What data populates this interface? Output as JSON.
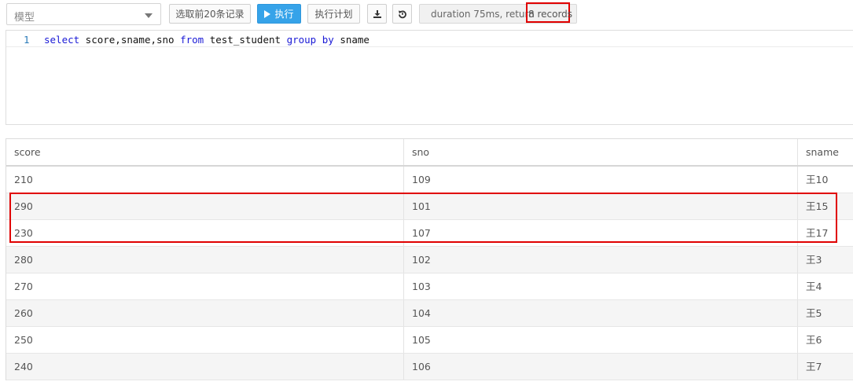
{
  "toolbar": {
    "model_select": {
      "value": "模型"
    },
    "select_top20_label": "选取前20条记录",
    "execute_label": "执行",
    "plan_label": "执行计划",
    "download_icon": "download-icon",
    "reset_icon": "undo-icon",
    "status_prefix": "duration 75ms, return ",
    "status_records": "8 records"
  },
  "editor": {
    "line_number": "1",
    "tokens": [
      {
        "text": "select",
        "kw": true
      },
      {
        "text": " score,sname,sno ",
        "kw": false
      },
      {
        "text": "from",
        "kw": true
      },
      {
        "text": " test_student ",
        "kw": false
      },
      {
        "text": "group",
        "kw": true
      },
      {
        "text": " ",
        "kw": false
      },
      {
        "text": "by",
        "kw": true
      },
      {
        "text": " sname",
        "kw": false
      }
    ]
  },
  "results": {
    "columns": [
      "score",
      "sno",
      "sname"
    ],
    "rows": [
      [
        "210",
        "109",
        "王10"
      ],
      [
        "290",
        "101",
        "王15"
      ],
      [
        "230",
        "107",
        "王17"
      ],
      [
        "280",
        "102",
        "王3"
      ],
      [
        "270",
        "103",
        "王4"
      ],
      [
        "260",
        "104",
        "王5"
      ],
      [
        "250",
        "105",
        "王6"
      ],
      [
        "240",
        "106",
        "王7"
      ]
    ]
  },
  "annotation": {
    "color": "#e00000"
  }
}
